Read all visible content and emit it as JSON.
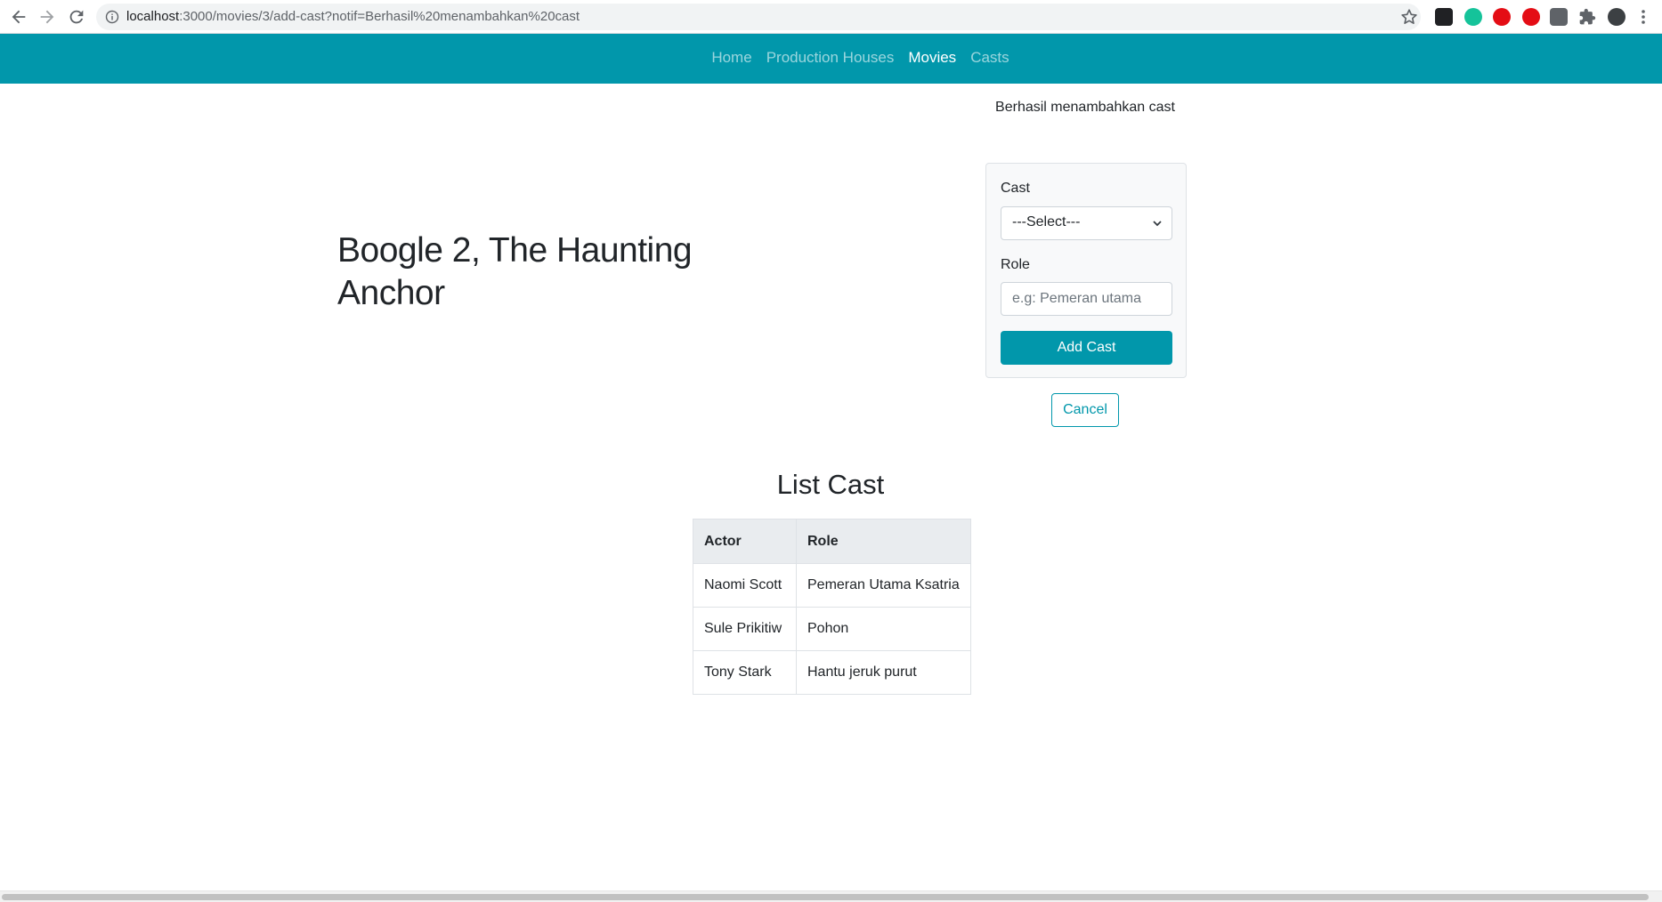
{
  "browser": {
    "url_host": "localhost",
    "url_rest": ":3000/movies/3/add-cast?notif=Berhasil%20menambahkan%20cast",
    "icons": [
      "back-arrow-icon",
      "forward-arrow-icon",
      "reload-icon",
      "info-icon",
      "star-icon",
      "trello-extension-icon",
      "grammarly-extension-icon",
      "adblock-extension-icon",
      "hand-extension-icon",
      "box-extension-icon",
      "puzzle-extension-icon",
      "profile-avatar-icon",
      "menu-dots-icon"
    ]
  },
  "navbar": {
    "links": [
      {
        "label": "Home",
        "active": false
      },
      {
        "label": "Production Houses",
        "active": false
      },
      {
        "label": "Movies",
        "active": true
      },
      {
        "label": "Casts",
        "active": false
      }
    ],
    "color": "#0197ab"
  },
  "movie": {
    "title": "Boogle 2, The Haunting Anchor"
  },
  "notification": "Berhasil menambahkan cast",
  "form": {
    "cast_label": "Cast",
    "cast_selected": "---Select---",
    "role_label": "Role",
    "role_placeholder": "e.g: Pemeran utama",
    "submit_label": "Add Cast",
    "cancel_label": "Cancel"
  },
  "cast_list": {
    "title": "List Cast",
    "headers": [
      "Actor",
      "Role"
    ],
    "rows": [
      {
        "actor": "Naomi Scott",
        "role": "Pemeran Utama Ksatria"
      },
      {
        "actor": "Sule Prikitiw",
        "role": "Pohon"
      },
      {
        "actor": "Tony Stark",
        "role": "Hantu jeruk purut"
      }
    ]
  }
}
